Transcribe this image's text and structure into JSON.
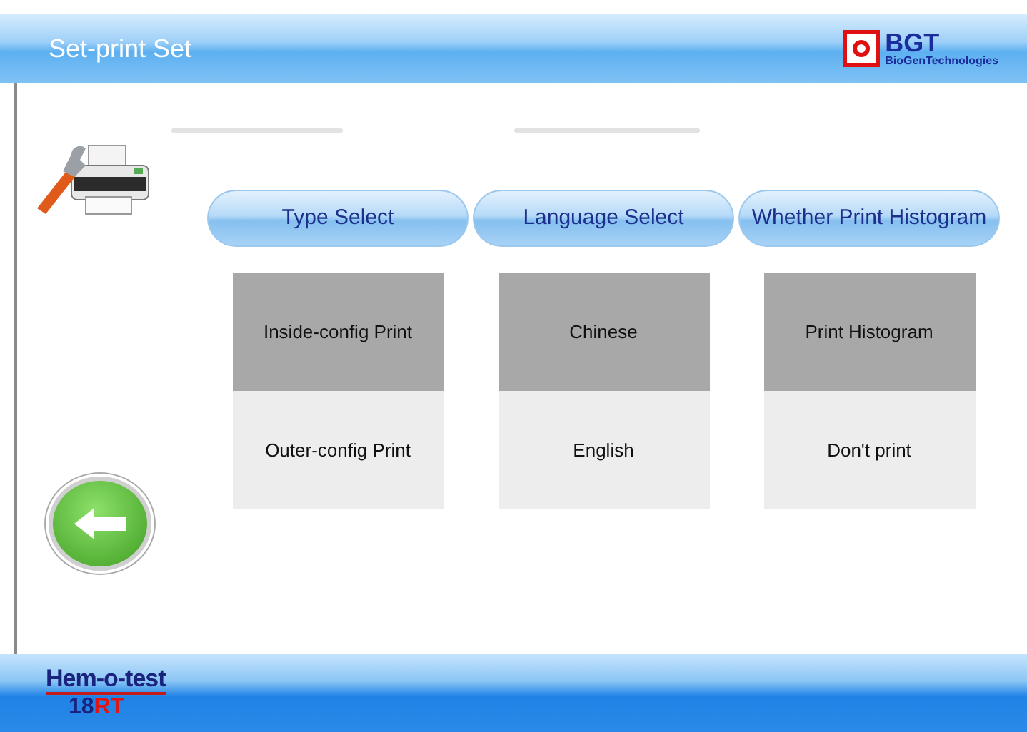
{
  "header": {
    "title": "Set-print Set",
    "logo": {
      "mark": "BGT",
      "subtitle": "BioGenTechnologies"
    }
  },
  "groups": [
    {
      "title": "Type Select",
      "options": [
        {
          "label": "Inside-config Print",
          "selected": true
        },
        {
          "label": "Outer-config Print",
          "selected": false
        }
      ]
    },
    {
      "title": "Language Select",
      "options": [
        {
          "label": "Chinese",
          "selected": true
        },
        {
          "label": "English",
          "selected": false
        }
      ]
    },
    {
      "title": "Whether Print Histogram",
      "options": [
        {
          "label": "Print Histogram",
          "selected": true
        },
        {
          "label": "Don't print",
          "selected": false
        }
      ]
    }
  ],
  "footer": {
    "brand": "Hem-o-test",
    "model_number": "18",
    "model_suffix": "RT"
  }
}
